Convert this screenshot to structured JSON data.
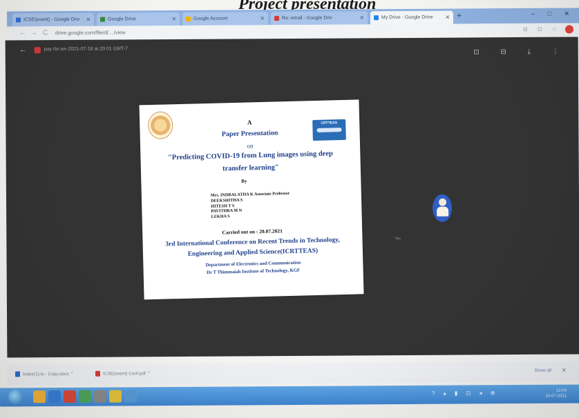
{
  "photo_caption": "Project presentation",
  "browser": {
    "tabs": [
      {
        "label": "ICSE(event) - Google Driv",
        "color": "#2f6fd6"
      },
      {
        "label": "Google Drive",
        "color": "#3a8a3a"
      },
      {
        "label": "Google Account",
        "color": "#f0b400"
      },
      {
        "label": "Re: email - Google Driv",
        "color": "#d63a3a"
      },
      {
        "label": "My Drive - Google Drive",
        "color": "#1e88e5"
      }
    ],
    "new_tab": "+",
    "window_controls": "– □ ✕",
    "nav": {
      "back": "←",
      "forward": "→",
      "reload": "C"
    },
    "url": "drive.google.com/file/d/…/view"
  },
  "viewer": {
    "back": "←",
    "file_title": "pay rbr-wv-2021-07-18 at 20.01 GMT-7",
    "actions": "⊡ ⊟ ⤓ ⋮",
    "presenter_tag": "You"
  },
  "slide": {
    "conf_logo_text": "CRTTEAS",
    "line_a": "A",
    "line_paper": "Paper Presentation",
    "line_on": "on",
    "title_1": "\"Predicting COVID-19 from Lung images using deep",
    "title_2": "transfer learning\"",
    "by": "By",
    "author_1": "Mrs. INDRALATHA K  Associate Professor",
    "author_2": "DEEKSHITHA S",
    "author_3": "HITESH T S",
    "author_4": "PAVITHRA M N",
    "author_5": "LEKHA S",
    "carried_out": "Carried out on : 20.07.2021",
    "conf_1": "3rd International Conference on Recent Trends in Technology,",
    "conf_2": "Engineering and Applied Science(ICRTTEAS)",
    "dept": "Department of Electronics and Communication",
    "institute": "Dr T Thimmaiah Institute of Technology, KGF"
  },
  "downloads": {
    "items": [
      {
        "name": "Index(1).ts - Copy.docx",
        "color": "#2b6dc9"
      },
      {
        "name": "ICSE(event) Conf.pdf",
        "color": "#d23b3b"
      }
    ],
    "show_all": "Show all",
    "close": "✕"
  },
  "taskbar": {
    "apps": [
      "#f2b33a",
      "#3a7ed6",
      "#d94a3a",
      "#4fa55a",
      "#8a8a8a",
      "#e3c23a",
      "#5a9ad6"
    ],
    "tray": "? ▴ ▮ ⊡ ◂ ⊕",
    "time": "12:04",
    "date": "20-07-2021"
  }
}
